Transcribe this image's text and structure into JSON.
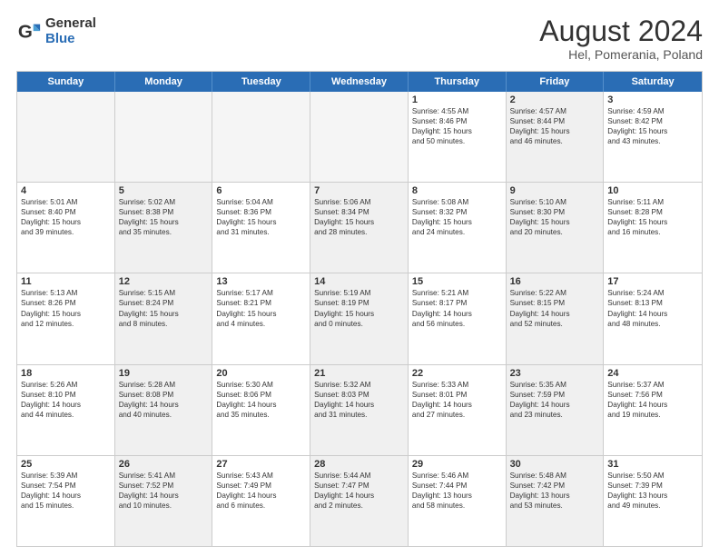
{
  "header": {
    "logo_general": "General",
    "logo_blue": "Blue",
    "title": "August 2024",
    "location": "Hel, Pomerania, Poland"
  },
  "weekdays": [
    "Sunday",
    "Monday",
    "Tuesday",
    "Wednesday",
    "Thursday",
    "Friday",
    "Saturday"
  ],
  "weeks": [
    [
      {
        "day": "",
        "info": "",
        "empty": true
      },
      {
        "day": "",
        "info": "",
        "empty": true
      },
      {
        "day": "",
        "info": "",
        "empty": true
      },
      {
        "day": "",
        "info": "",
        "empty": true
      },
      {
        "day": "1",
        "info": "Sunrise: 4:55 AM\nSunset: 8:46 PM\nDaylight: 15 hours\nand 50 minutes.",
        "shaded": false
      },
      {
        "day": "2",
        "info": "Sunrise: 4:57 AM\nSunset: 8:44 PM\nDaylight: 15 hours\nand 46 minutes.",
        "shaded": true
      },
      {
        "day": "3",
        "info": "Sunrise: 4:59 AM\nSunset: 8:42 PM\nDaylight: 15 hours\nand 43 minutes.",
        "shaded": false
      }
    ],
    [
      {
        "day": "4",
        "info": "Sunrise: 5:01 AM\nSunset: 8:40 PM\nDaylight: 15 hours\nand 39 minutes.",
        "shaded": false
      },
      {
        "day": "5",
        "info": "Sunrise: 5:02 AM\nSunset: 8:38 PM\nDaylight: 15 hours\nand 35 minutes.",
        "shaded": true
      },
      {
        "day": "6",
        "info": "Sunrise: 5:04 AM\nSunset: 8:36 PM\nDaylight: 15 hours\nand 31 minutes.",
        "shaded": false
      },
      {
        "day": "7",
        "info": "Sunrise: 5:06 AM\nSunset: 8:34 PM\nDaylight: 15 hours\nand 28 minutes.",
        "shaded": true
      },
      {
        "day": "8",
        "info": "Sunrise: 5:08 AM\nSunset: 8:32 PM\nDaylight: 15 hours\nand 24 minutes.",
        "shaded": false
      },
      {
        "day": "9",
        "info": "Sunrise: 5:10 AM\nSunset: 8:30 PM\nDaylight: 15 hours\nand 20 minutes.",
        "shaded": true
      },
      {
        "day": "10",
        "info": "Sunrise: 5:11 AM\nSunset: 8:28 PM\nDaylight: 15 hours\nand 16 minutes.",
        "shaded": false
      }
    ],
    [
      {
        "day": "11",
        "info": "Sunrise: 5:13 AM\nSunset: 8:26 PM\nDaylight: 15 hours\nand 12 minutes.",
        "shaded": false
      },
      {
        "day": "12",
        "info": "Sunrise: 5:15 AM\nSunset: 8:24 PM\nDaylight: 15 hours\nand 8 minutes.",
        "shaded": true
      },
      {
        "day": "13",
        "info": "Sunrise: 5:17 AM\nSunset: 8:21 PM\nDaylight: 15 hours\nand 4 minutes.",
        "shaded": false
      },
      {
        "day": "14",
        "info": "Sunrise: 5:19 AM\nSunset: 8:19 PM\nDaylight: 15 hours\nand 0 minutes.",
        "shaded": true
      },
      {
        "day": "15",
        "info": "Sunrise: 5:21 AM\nSunset: 8:17 PM\nDaylight: 14 hours\nand 56 minutes.",
        "shaded": false
      },
      {
        "day": "16",
        "info": "Sunrise: 5:22 AM\nSunset: 8:15 PM\nDaylight: 14 hours\nand 52 minutes.",
        "shaded": true
      },
      {
        "day": "17",
        "info": "Sunrise: 5:24 AM\nSunset: 8:13 PM\nDaylight: 14 hours\nand 48 minutes.",
        "shaded": false
      }
    ],
    [
      {
        "day": "18",
        "info": "Sunrise: 5:26 AM\nSunset: 8:10 PM\nDaylight: 14 hours\nand 44 minutes.",
        "shaded": false
      },
      {
        "day": "19",
        "info": "Sunrise: 5:28 AM\nSunset: 8:08 PM\nDaylight: 14 hours\nand 40 minutes.",
        "shaded": true
      },
      {
        "day": "20",
        "info": "Sunrise: 5:30 AM\nSunset: 8:06 PM\nDaylight: 14 hours\nand 35 minutes.",
        "shaded": false
      },
      {
        "day": "21",
        "info": "Sunrise: 5:32 AM\nSunset: 8:03 PM\nDaylight: 14 hours\nand 31 minutes.",
        "shaded": true
      },
      {
        "day": "22",
        "info": "Sunrise: 5:33 AM\nSunset: 8:01 PM\nDaylight: 14 hours\nand 27 minutes.",
        "shaded": false
      },
      {
        "day": "23",
        "info": "Sunrise: 5:35 AM\nSunset: 7:59 PM\nDaylight: 14 hours\nand 23 minutes.",
        "shaded": true
      },
      {
        "day": "24",
        "info": "Sunrise: 5:37 AM\nSunset: 7:56 PM\nDaylight: 14 hours\nand 19 minutes.",
        "shaded": false
      }
    ],
    [
      {
        "day": "25",
        "info": "Sunrise: 5:39 AM\nSunset: 7:54 PM\nDaylight: 14 hours\nand 15 minutes.",
        "shaded": false
      },
      {
        "day": "26",
        "info": "Sunrise: 5:41 AM\nSunset: 7:52 PM\nDaylight: 14 hours\nand 10 minutes.",
        "shaded": true
      },
      {
        "day": "27",
        "info": "Sunrise: 5:43 AM\nSunset: 7:49 PM\nDaylight: 14 hours\nand 6 minutes.",
        "shaded": false
      },
      {
        "day": "28",
        "info": "Sunrise: 5:44 AM\nSunset: 7:47 PM\nDaylight: 14 hours\nand 2 minutes.",
        "shaded": true
      },
      {
        "day": "29",
        "info": "Sunrise: 5:46 AM\nSunset: 7:44 PM\nDaylight: 13 hours\nand 58 minutes.",
        "shaded": false
      },
      {
        "day": "30",
        "info": "Sunrise: 5:48 AM\nSunset: 7:42 PM\nDaylight: 13 hours\nand 53 minutes.",
        "shaded": true
      },
      {
        "day": "31",
        "info": "Sunrise: 5:50 AM\nSunset: 7:39 PM\nDaylight: 13 hours\nand 49 minutes.",
        "shaded": false
      }
    ]
  ]
}
